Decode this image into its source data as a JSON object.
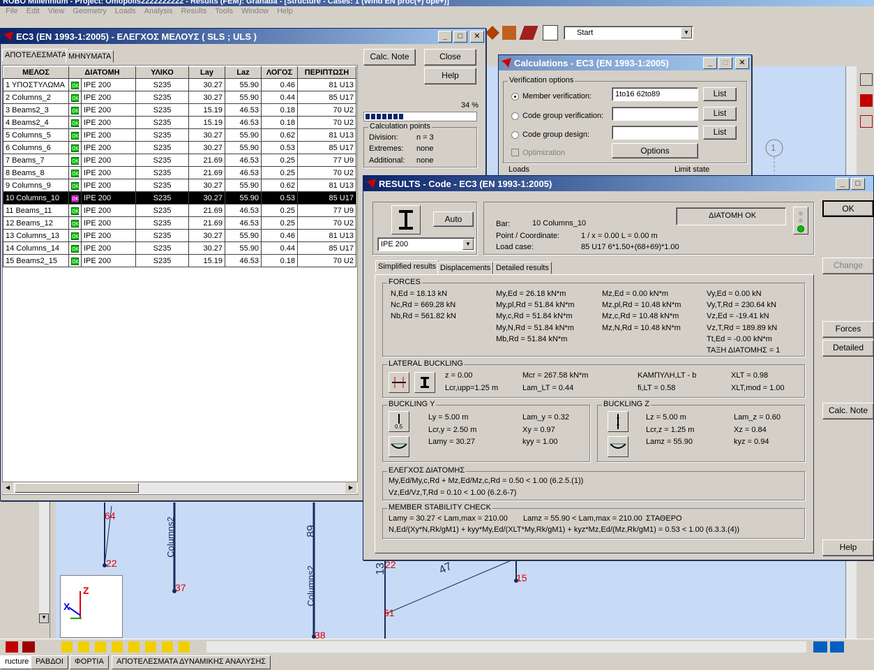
{
  "app": {
    "title": "ROBO Millennium - Project: Omopolis2222222222 - Results (FEM): Granada - [Structure - Cases: 1 (Wind EN proc(+) ope+)]",
    "menu": [
      "File",
      "Edit",
      "View",
      "Geometry",
      "Loads",
      "Analysis",
      "Results",
      "Tools",
      "Window",
      "Help"
    ],
    "toolbar_combo": "Start"
  },
  "member_check": {
    "title": "EC3 (EN 1993-1:2005) - ΕΛΕΓΧΟΣ ΜΕΛΟΥΣ ( SLS ; ULS )",
    "tabs": [
      "ΑΠΟΤΕΛΕΣΜΑΤΑ",
      "ΜΗΝΥΜΑΤΑ"
    ],
    "columns": [
      "ΜΕΛΟΣ",
      "ΔΙΑΤΟΜΗ",
      "ΥΛΙΚΟ",
      "Lay",
      "Laz",
      "ΛΟΓΟΣ",
      "ΠΕΡΙΠΤΩΣΗ"
    ],
    "ok_text": "OK",
    "rows": [
      {
        "member": "1  ΥΠΟΣΤΥΛΩΜΑ",
        "section": "IPE 200",
        "material": "S235",
        "lay": "30.27",
        "laz": "55.90",
        "ratio": "0.46",
        "case": "81 U13"
      },
      {
        "member": "2  Columns_2",
        "section": "IPE 200",
        "material": "S235",
        "lay": "30.27",
        "laz": "55.90",
        "ratio": "0.44",
        "case": "85 U17"
      },
      {
        "member": "3  Beams2_3",
        "section": "IPE 200",
        "material": "S235",
        "lay": "15.19",
        "laz": "46.53",
        "ratio": "0.18",
        "case": "70 U2"
      },
      {
        "member": "4  Beams2_4",
        "section": "IPE 200",
        "material": "S235",
        "lay": "15.19",
        "laz": "46.53",
        "ratio": "0.18",
        "case": "70 U2"
      },
      {
        "member": "5  Columns_5",
        "section": "IPE 200",
        "material": "S235",
        "lay": "30.27",
        "laz": "55.90",
        "ratio": "0.62",
        "case": "81 U13"
      },
      {
        "member": "6  Columns_6",
        "section": "IPE 200",
        "material": "S235",
        "lay": "30.27",
        "laz": "55.90",
        "ratio": "0.53",
        "case": "85 U17"
      },
      {
        "member": "7  Beams_7",
        "section": "IPE 200",
        "material": "S235",
        "lay": "21.69",
        "laz": "46.53",
        "ratio": "0.25",
        "case": "77 U9"
      },
      {
        "member": "8  Beams_8",
        "section": "IPE 200",
        "material": "S235",
        "lay": "21.69",
        "laz": "46.53",
        "ratio": "0.25",
        "case": "70 U2"
      },
      {
        "member": "9  Columns_9",
        "section": "IPE 200",
        "material": "S235",
        "lay": "30.27",
        "laz": "55.90",
        "ratio": "0.62",
        "case": "81 U13"
      },
      {
        "member": "10  Columns_10",
        "section": "IPE 200",
        "material": "S235",
        "lay": "30.27",
        "laz": "55.90",
        "ratio": "0.53",
        "case": "85 U17"
      },
      {
        "member": "11  Beams_11",
        "section": "IPE 200",
        "material": "S235",
        "lay": "21.69",
        "laz": "46.53",
        "ratio": "0.25",
        "case": "77 U9"
      },
      {
        "member": "12  Beams_12",
        "section": "IPE 200",
        "material": "S235",
        "lay": "21.69",
        "laz": "46.53",
        "ratio": "0.25",
        "case": "70 U2"
      },
      {
        "member": "13  Columns_13",
        "section": "IPE 200",
        "material": "S235",
        "lay": "30.27",
        "laz": "55.90",
        "ratio": "0.46",
        "case": "81 U13"
      },
      {
        "member": "14  Columns_14",
        "section": "IPE 200",
        "material": "S235",
        "lay": "30.27",
        "laz": "55.90",
        "ratio": "0.44",
        "case": "85 U17"
      },
      {
        "member": "15  Beams2_15",
        "section": "IPE 200",
        "material": "S235",
        "lay": "15.19",
        "laz": "46.53",
        "ratio": "0.18",
        "case": "70 U2"
      }
    ],
    "selected_row": 9,
    "buttons": {
      "calc_note": "Calc. Note",
      "close": "Close",
      "help": "Help"
    },
    "progress_text": "34 %",
    "progress_fraction": 0.34,
    "calc_points": {
      "label": "Calculation points",
      "division_label": "Division:",
      "division": "n = 3",
      "extremes_label": "Extremes:",
      "extremes": "none",
      "additional_label": "Additional:",
      "additional": "none"
    }
  },
  "calculations": {
    "title": "Calculations - EC3 (EN 1993-1:2005)",
    "verification_options": "Verification options",
    "member_verification": "Member verification:",
    "member_list": "1to16 62to89",
    "code_group_verification": "Code group verification:",
    "code_group_design": "Code group design:",
    "list_button": "List",
    "optimization": "Optimization",
    "options_button": "Options",
    "loads_label": "Loads",
    "limit_state_label": "Limit state"
  },
  "results": {
    "title": "RESULTS - Code - EC3 (EN 1993-1:2005)",
    "auto_button": "Auto",
    "section_select": "IPE 200",
    "section_ok": "ΔΙΑΤΟΜΗ OK",
    "bar_label": "Bar:",
    "bar_value": "10  Columns_10",
    "point_label": "Point / Coordinate:",
    "point_value": "1 / x = 0.00 L = 0.00 m",
    "loadcase_label": "Load case:",
    "loadcase_value": "85 U17  6*1.50+(68+69)*1.00",
    "tabs": [
      "Simplified results",
      "Displacements",
      "Detailed results"
    ],
    "forces": {
      "label": "FORCES",
      "c1": [
        "N,Ed = 18.13 kN",
        "Nc,Rd = 669.28 kN",
        "Nb,Rd = 561.82 kN"
      ],
      "c2": [
        "My,Ed = 26.18 kN*m",
        "My,pl,Rd = 51.84 kN*m",
        "My,c,Rd = 51.84 kN*m",
        "My,N,Rd = 51.84 kN*m",
        "Mb,Rd = 51.84 kN*m"
      ],
      "c3": [
        "Mz,Ed = 0.00 kN*m",
        "Mz,pl,Rd = 10.48 kN*m",
        "Mz,c,Rd = 10.48 kN*m",
        "Mz,N,Rd = 10.48 kN*m"
      ],
      "c4": [
        "Vy,Ed = 0.00 kN",
        "Vy,T,Rd = 230.64 kN",
        "Vz,Ed = -19.41 kN",
        "Vz,T,Rd = 189.89 kN",
        "Tt,Ed = -0.00 kN*m",
        "ΤΑΞΗ ΔΙΑΤΟΜΗΣ = 1"
      ]
    },
    "lateral": {
      "label": "LATERAL BUCKLING",
      "z": "z = 0.00",
      "lcr": "Lcr,upp=1.25 m",
      "mcr": "Mcr = 267.58 kN*m",
      "lam": "Lam_LT = 0.44",
      "curve": "ΚΑΜΠΥΛΗ,LT - b",
      "fi": "fi,LT = 0.58",
      "xlt": "XLT = 0.98",
      "xltmod": "XLT,mod = 1.00"
    },
    "buckling_y": {
      "label": "BUCKLING Y",
      "icon_text": "0.5",
      "l": "Ly = 5.00 m",
      "lcr": "Lcr,y = 2.50 m",
      "lam": "Lamy = 30.27",
      "lam2": "Lam_y = 0.32",
      "x": "Xy = 0.97",
      "k": "kyy = 1.00"
    },
    "buckling_z": {
      "label": "BUCKLING Z",
      "l": "Lz = 5.00 m",
      "lcr": "Lcr,z = 1.25 m",
      "lam": "Lamz = 55.90",
      "lam2": "Lam_z = 0.60",
      "x": "Xz = 0.84",
      "k": "kyz = 0.94"
    },
    "section_check": {
      "label": "ΕΛΕΓΧΟΣ ΔΙΑΤΟΜΗΣ",
      "l1": "My,Ed/My,c,Rd + Mz,Ed/Mz,c,Rd = 0.50 < 1.00   (6.2.5.(1))",
      "l2": "Vz,Ed/Vz,T,Rd = 0.10 < 1.00   (6.2.6-7)"
    },
    "stability": {
      "label": "MEMBER STABILITY CHECK",
      "l1a": "Lamy = 30.27 < Lam,max = 210.00",
      "l1b": "Lamz = 55.90 < Lam,max = 210.00",
      "l1c": "ΣΤΑΘΕΡΟ",
      "l2": "N,Ed/(Xy*N,Rk/gM1) + kyy*My,Ed/(XLT*My,Rk/gM1) + kyz*Mz,Ed/(Mz,Rk/gM1) = 0.53 < 1.00   (6.3.3.(4))"
    },
    "buttons": {
      "ok": "OK",
      "change": "Change",
      "forces": "Forces",
      "detailed": "Detailed",
      "calc_note": "Calc. Note",
      "help": "Help"
    }
  },
  "view": {
    "node_labels": [
      "64",
      "22",
      "37",
      "89",
      "22",
      "13",
      "47",
      "15",
      "61",
      "38",
      "1"
    ],
    "member_labels": [
      "Columns2",
      "Columns2"
    ],
    "axis_z": "Z",
    "axis_x": "X"
  },
  "bottom_tabs": [
    "ructure",
    "ΡΑΒΔΟΙ",
    "ΦΟΡΤΙΑ",
    "ΑΠΟΤΕΛΕΣΜΑΤΑ ΔΥΝΑΜΙΚΗΣ ΑΝΑΛΥΣΗΣ"
  ],
  "colors": {
    "title_active": "#0a246a",
    "title_inactive": "#808080",
    "canvas": "#c7dbf7",
    "ok_green": "#00c000",
    "label_red": "#e00000"
  }
}
